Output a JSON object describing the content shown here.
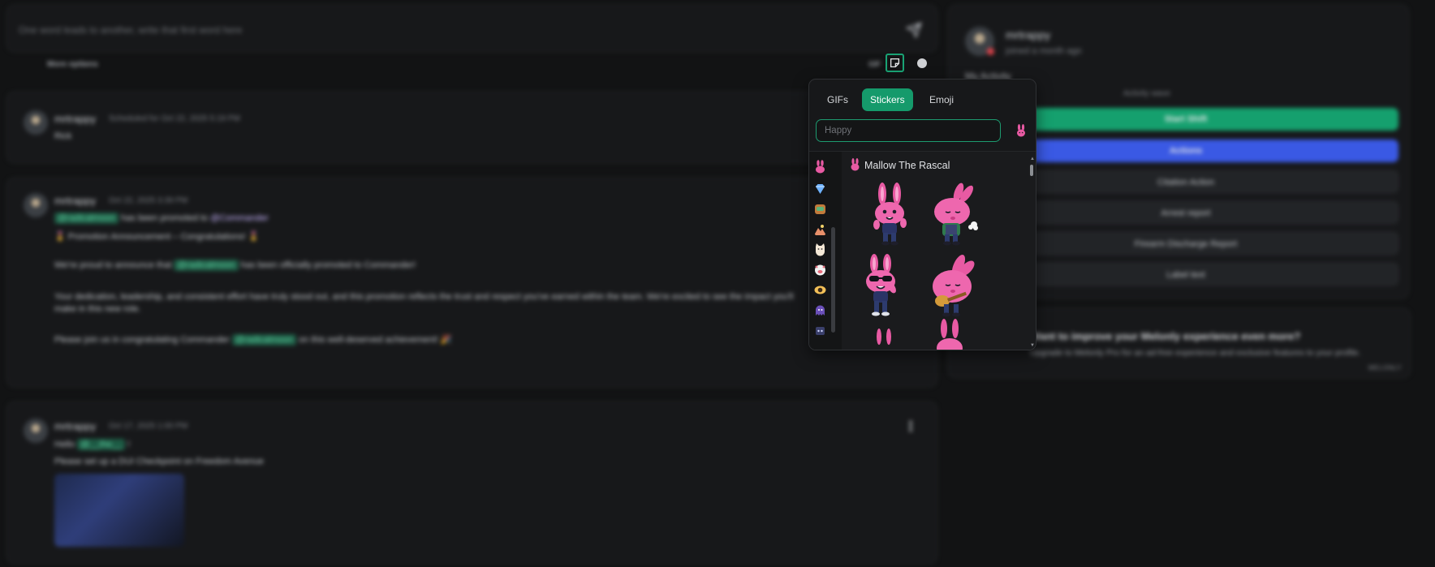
{
  "composer": {
    "placeholder": "One word leads to another, write that first word here"
  },
  "options_bar": {
    "more_options": "More options",
    "gif_label": "GIF"
  },
  "posts": [
    {
      "username": "mrtrappy",
      "meta": "Scheduled for Oct 22, 2025 5:19 PM",
      "text": "Rick"
    },
    {
      "username": "mrtrappy",
      "meta": "Oct 22, 2025 3:39 PM",
      "line1_mention": "@radicalmoon",
      "line1_text": "has been promoted to",
      "line1_mention2": "@Commander",
      "line2": "🎖️ Promotion Announcement – Congratulations! 🎖️",
      "line3_pre": "We're proud to announce that",
      "line3_mention": "@radicalmoon",
      "line3_post": "has been officially promoted to Commander!",
      "line4": "Your dedication, leadership, and consistent effort have truly stood out, and this promotion reflects the trust and respect you've earned within the team. We're excited to see the impact you'll",
      "line5": "make in this new role.",
      "line6_pre": "Please join us in congratulating Commander",
      "line6_mention": "@radicalmoon",
      "line6_post": "on this well-deserved achievement! 🎉"
    },
    {
      "username": "mrtrappy",
      "meta": "Oct 17, 2025 1:00 PM",
      "line1_pre": "Hello",
      "line1_mention": "@__the__",
      "line1_post": "!",
      "line2": "Please set up a DUI Checkpoint on Freedom Avenue"
    }
  ],
  "profile": {
    "name": "mrtrappy",
    "joined": "joined a month ago",
    "my_activity": "My Activity",
    "activity_wave": "Activity wave",
    "buttons": {
      "start_shift": "Start Shift",
      "actions": "Actions",
      "citation": "Citation Action",
      "arrest": "Arrest report",
      "firearm": "Firearm Discharge Report",
      "label": "Label text"
    }
  },
  "promo": {
    "title": "Want to improve your Melonly experience even more?",
    "subtitle": "Upgrade to Melonly Pro for an ad-free experience and exclusive features to your profile.",
    "tag": "MELONLY"
  },
  "picker": {
    "tabs": {
      "gifs": "GIFs",
      "stickers": "Stickers",
      "emoji": "Emoji"
    },
    "search_placeholder": "Happy",
    "pack_title": "Mallow The Rascal"
  },
  "colors": {
    "accent_green": "#159a6b",
    "accent_blue": "#3a59e4",
    "bunny_pink": "#e85aa3"
  },
  "icons": {
    "send": "send-icon",
    "sticker": "sticker-icon",
    "emoji": "emoji-icon",
    "chevron": "chevron-down-icon",
    "more": "more-vertical-icon"
  }
}
